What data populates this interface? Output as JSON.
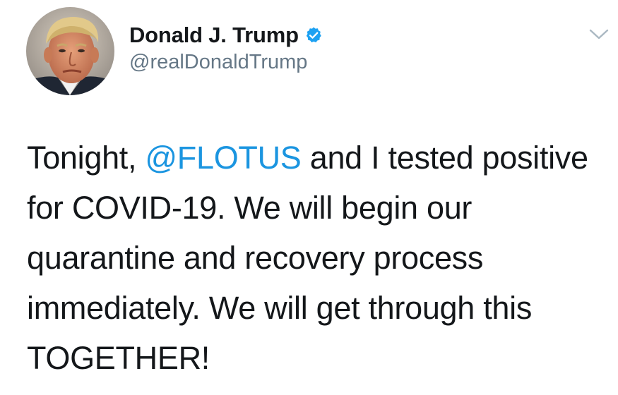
{
  "author": {
    "display_name": "Donald J. Trump",
    "handle": "@realDonaldTrump",
    "verified": true
  },
  "tweet": {
    "text_before_mention": "Tonight, ",
    "mention": "@FLOTUS",
    "text_after_mention": " and I tested positive for COVID-19. We will begin our quarantine and recovery process immediately. We will get through this TOGETHER!"
  },
  "icons": {
    "verified": "verified-badge-icon",
    "menu": "chevron-down-icon"
  },
  "colors": {
    "mention": "#1b95e0",
    "verified_badge": "#1da1f2",
    "handle": "#657786",
    "text": "#14171a",
    "chevron": "#aab8c2"
  }
}
